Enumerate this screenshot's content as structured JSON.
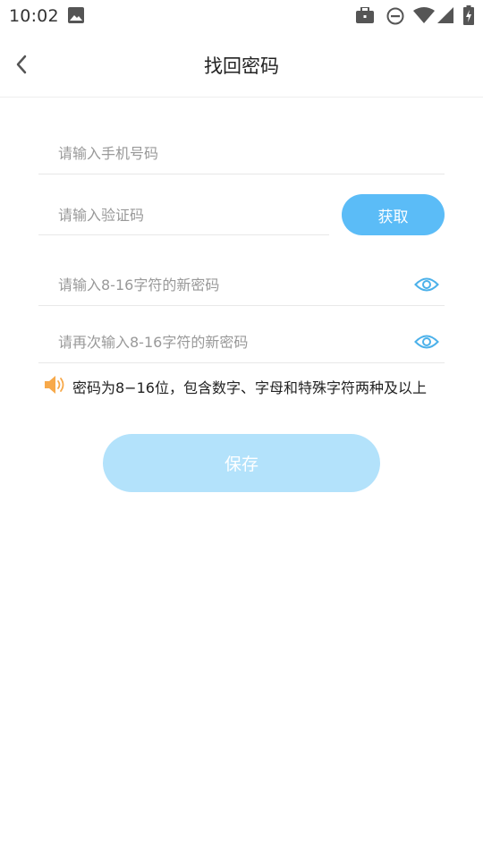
{
  "status_bar": {
    "time": "10:02",
    "icons": [
      "image-icon",
      "briefcase-icon",
      "do-not-disturb-icon",
      "wifi-icon",
      "signal-icon",
      "battery-charging-icon"
    ]
  },
  "header": {
    "back_icon": "chevron-left-icon",
    "title": "找回密码"
  },
  "form": {
    "phone": {
      "placeholder": "请输入手机号码",
      "value": ""
    },
    "code": {
      "placeholder": "请输入验证码",
      "value": ""
    },
    "get_code_label": "获取",
    "password": {
      "placeholder": "请输入8-16字符的新密码",
      "value": ""
    },
    "confirm_password": {
      "placeholder": "请再次输入8-16字符的新密码",
      "value": ""
    },
    "eye_icon": "eye-icon"
  },
  "hint": {
    "icon": "speaker-icon",
    "text": "密码为8−16位，包含数字、字母和特殊字符两种及以上"
  },
  "save_label": "保存",
  "colors": {
    "accent": "#5bbcf7",
    "save_disabled": "#b3e2fb",
    "hint_icon": "#f7a94a",
    "eye_icon": "#4cb1ea"
  }
}
